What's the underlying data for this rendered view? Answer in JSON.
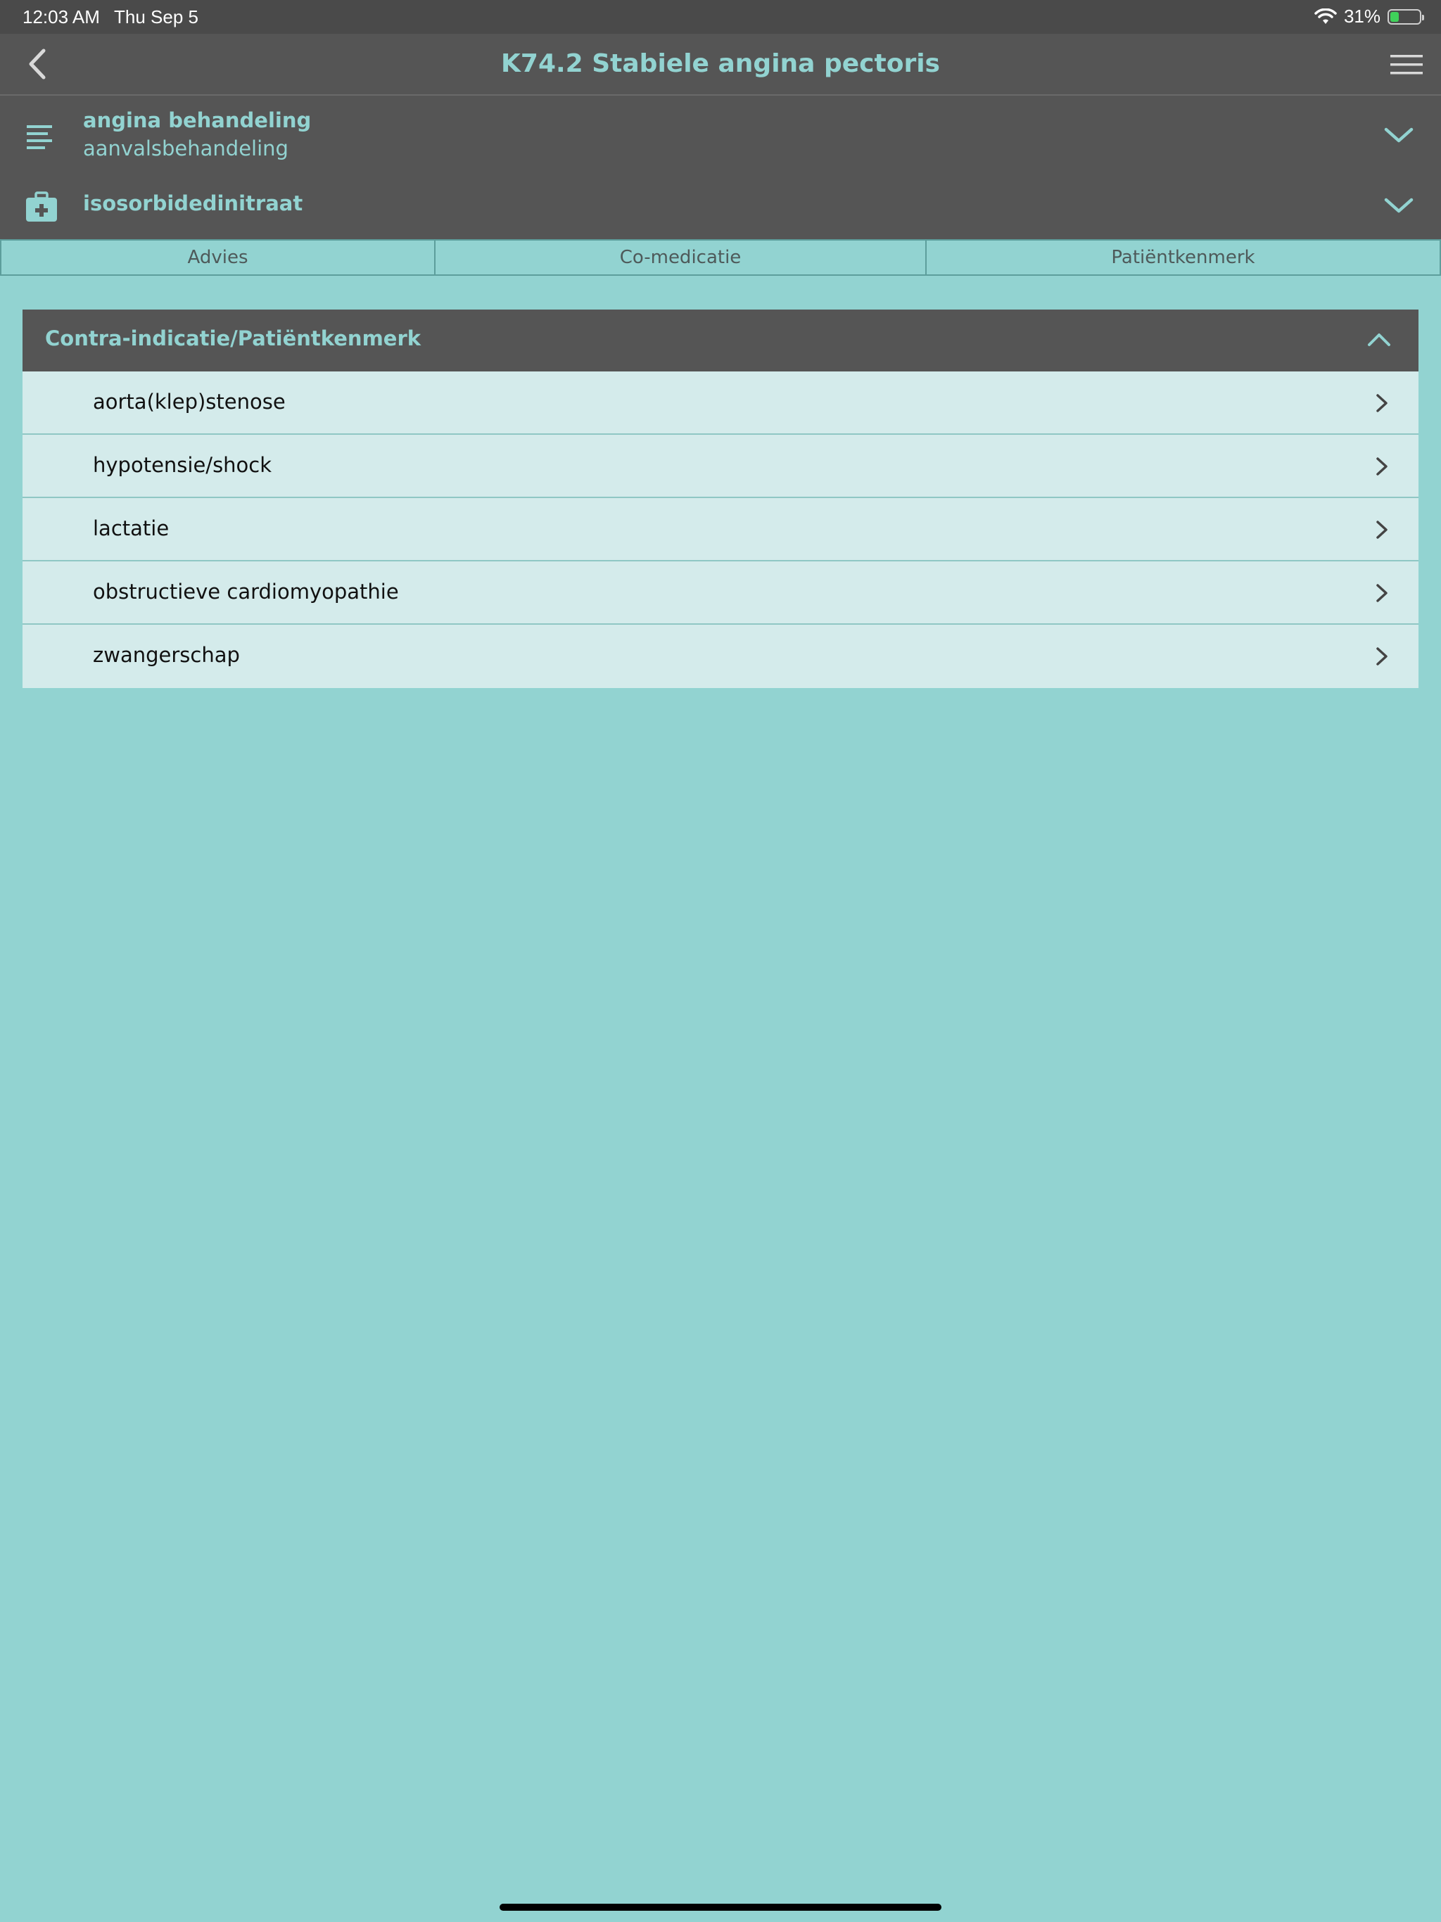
{
  "status_bar": {
    "time": "12:03 AM",
    "date": "Thu Sep 5",
    "battery": "31%",
    "battery_level": 0.31
  },
  "nav": {
    "title": "K74.2 Stabiele angina pectoris"
  },
  "selectors": {
    "treatment": {
      "title": "angina behandeling",
      "subtitle": "aanvalsbehandeling"
    },
    "medication": {
      "title": "isosorbidedinitraat"
    }
  },
  "tabs": [
    {
      "label": "Advies"
    },
    {
      "label": "Co-medicatie"
    },
    {
      "label": "Patiëntkenmerk"
    }
  ],
  "panel": {
    "title": "Contra-indicatie/Patiëntkenmerk",
    "items": [
      {
        "label": "aorta(klep)stenose"
      },
      {
        "label": "hypotensie/shock"
      },
      {
        "label": "lactatie"
      },
      {
        "label": "obstructieve cardiomyopathie"
      },
      {
        "label": "zwangerschap"
      }
    ]
  },
  "colors": {
    "accent": "#92d3d1",
    "bar": "#555555",
    "row": "#d4ebeb"
  }
}
